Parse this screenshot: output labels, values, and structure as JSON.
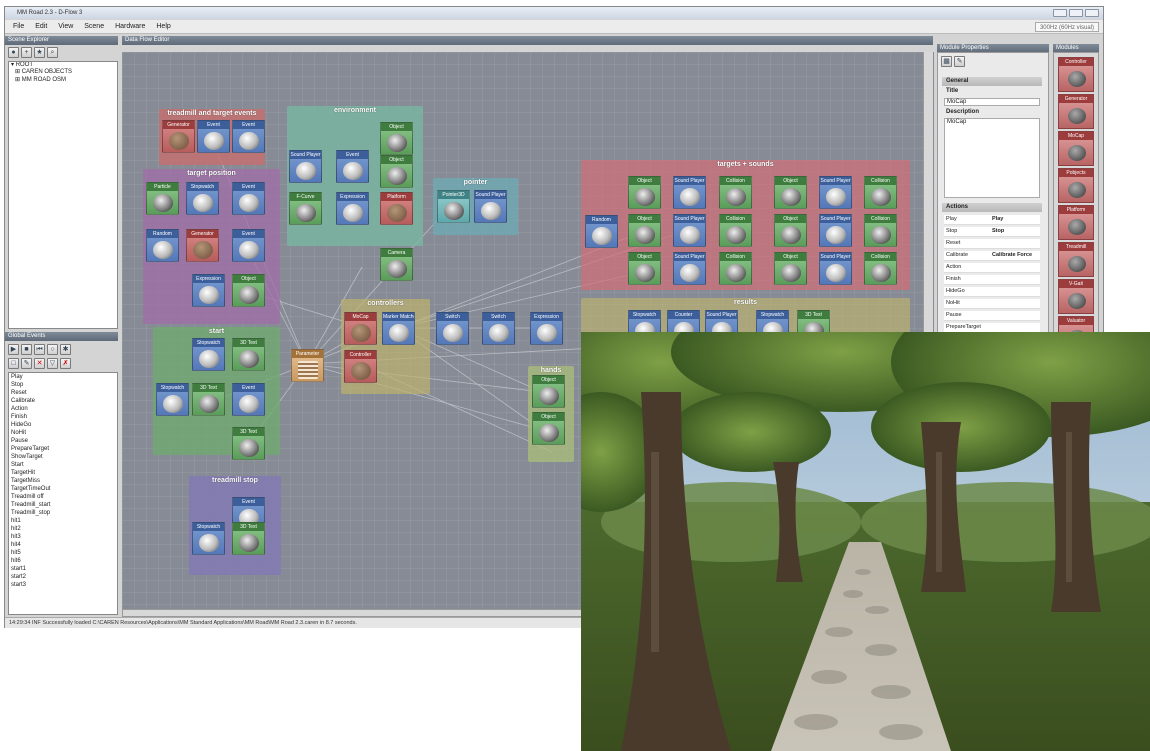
{
  "app": {
    "title": "MM Road 2.3 - D-Flow 3",
    "refresh_rate": "300Hz (60Hz visual)"
  },
  "menu": [
    "File",
    "Edit",
    "View",
    "Scene",
    "Hardware",
    "Help"
  ],
  "panels": {
    "scene_explorer": "Scene Explorer",
    "global_events": "Global Events",
    "data_flow_editor": "Data Flow Editor",
    "module_properties": "Module Properties",
    "modules": "Modules"
  },
  "scene_tree": [
    "ROOT",
    "CAREN OBJECTS",
    "MM ROAD OSM"
  ],
  "global_events": [
    "Play",
    "Stop",
    "Reset",
    "Calibrate",
    "Action",
    "Finish",
    "HideGo",
    "NoHit",
    "Pause",
    "PrepareTarget",
    "ShowTarget",
    "Start",
    "TargetHit",
    "TargetMiss",
    "TargetTimeOut",
    "Treadmill off",
    "Treadmill_start",
    "Treadmill_stop",
    "hit1",
    "hit2",
    "hit3",
    "hit4",
    "hit5",
    "hit6",
    "start1",
    "start2",
    "start3"
  ],
  "groups": {
    "g1": "treadmill and target events",
    "g2": "environment",
    "g3": "target position",
    "g4": "pointer",
    "g5": "targets + sounds",
    "g6": "controllers",
    "g7": "results",
    "g8": "start",
    "g9": "hands",
    "g10": "treadmill stop"
  },
  "modules_in_canvas": [
    "Generator",
    "Event",
    "Event",
    "Sound Player",
    "Event",
    "Object",
    "Object",
    "Particle",
    "Stopwatch",
    "Event",
    "F-Curve",
    "Expression",
    "Platform",
    "Random",
    "Generator",
    "Event",
    "Pointer3D",
    "Sound Player",
    "Camera",
    "Expression",
    "Object",
    "MoCap",
    "Marker Matcher",
    "Switch",
    "Switch",
    "Expression",
    "Stopwatch",
    "3D Text",
    "Parameter",
    "Controller",
    "Object",
    "Object",
    "Stopwatch",
    "3D Text",
    "Event",
    "3D Text",
    "Event",
    "Stopwatch",
    "3D Text",
    "Random",
    "Object",
    "Sound Player",
    "Collision",
    "Object",
    "Sound Player",
    "Collision",
    "Object",
    "Sound Player",
    "Collision",
    "Object",
    "Sound Player",
    "Collision",
    "Object",
    "Sound Player",
    "Collision",
    "Object",
    "Sound Player",
    "Collision",
    "Stopwatch",
    "Counter",
    "Sound Player",
    "Stopwatch",
    "3D Text"
  ],
  "properties": {
    "general": "General",
    "title_label": "Title",
    "title_value": "MoCap",
    "description_label": "Description",
    "description_value": "MoCap",
    "actions": "Actions",
    "action_rows": [
      {
        "k": "Play",
        "v": "Play"
      },
      {
        "k": "Stop",
        "v": "Stop"
      },
      {
        "k": "Reset",
        "v": ""
      },
      {
        "k": "Calibrate",
        "v": "Calibrate Force"
      },
      {
        "k": "Action",
        "v": ""
      },
      {
        "k": "Finish",
        "v": ""
      },
      {
        "k": "HideGo",
        "v": ""
      },
      {
        "k": "NoHit",
        "v": ""
      },
      {
        "k": "Pause",
        "v": ""
      },
      {
        "k": "PrepareTarget",
        "v": ""
      }
    ]
  },
  "library": [
    "Controller",
    "Generator",
    "MoCap",
    "Pobjects",
    "Platform",
    "Treadmill",
    "V-Gait",
    "Valuator"
  ],
  "status": "14:29:34 INF Successfully loaded C:\\CAREN Resources\\Applications\\MM Standard Applications\\MM Road\\MM Road 2.3.caren in 8.7 seconds."
}
